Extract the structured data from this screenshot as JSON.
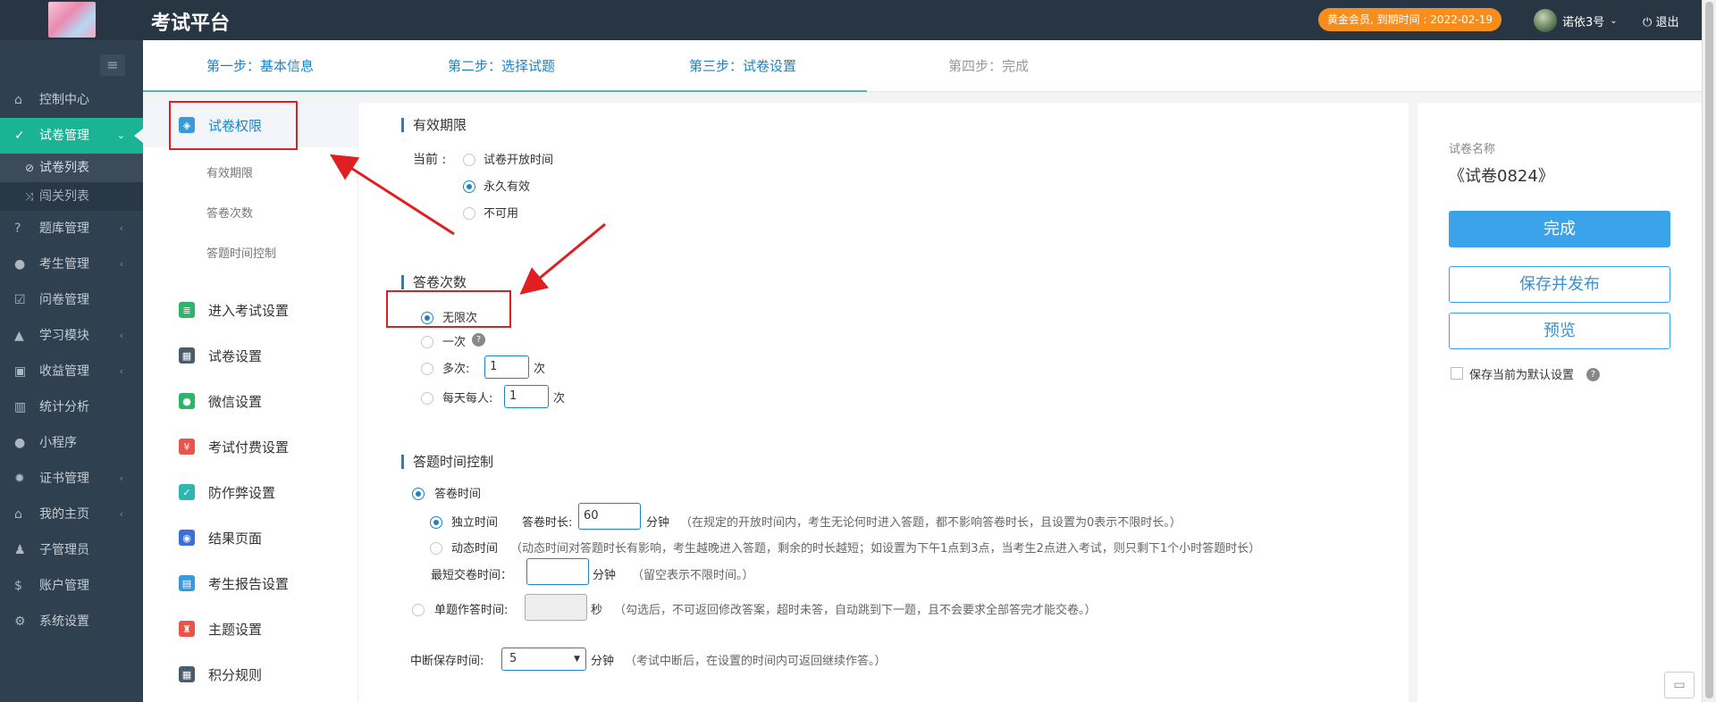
{
  "header": {
    "title": "考试平台",
    "member_badge": "黄金会员, 到期时间 : 2022-02-19",
    "username": "诺依3号",
    "logout": "退出"
  },
  "sidebar": {
    "items": [
      {
        "label": "控制中心",
        "icon": "home-icon"
      },
      {
        "label": "试卷管理",
        "icon": "check-circle-icon",
        "active": true
      },
      {
        "label": "题库管理",
        "icon": "question-circle-icon"
      },
      {
        "label": "考生管理",
        "icon": "user-icon"
      },
      {
        "label": "问卷管理",
        "icon": "check-square-icon"
      },
      {
        "label": "学习模块",
        "icon": "graduation-cap-icon"
      },
      {
        "label": "收益管理",
        "icon": "money-icon"
      },
      {
        "label": "统计分析",
        "icon": "bar-chart-icon"
      },
      {
        "label": "小程序",
        "icon": "wechat-icon"
      },
      {
        "label": "证书管理",
        "icon": "certificate-icon"
      },
      {
        "label": "我的主页",
        "icon": "bank-icon"
      },
      {
        "label": "子管理员",
        "icon": "user-secret-icon"
      },
      {
        "label": "账户管理",
        "icon": "dollar-icon"
      },
      {
        "label": "系统设置",
        "icon": "gear-icon"
      }
    ],
    "subitems": [
      {
        "label": "试卷列表",
        "icon": "check-circle-icon"
      },
      {
        "label": "闯关列表",
        "icon": "random-icon"
      }
    ]
  },
  "steps": [
    "第一步：基本信息",
    "第二步：选择试题",
    "第三步：试卷设置",
    "第四步：完成"
  ],
  "leftmenu": {
    "items": [
      {
        "label": "试卷权限"
      },
      {
        "label": "进入考试设置"
      },
      {
        "label": "试卷设置"
      },
      {
        "label": "微信设置"
      },
      {
        "label": "考试付费设置"
      },
      {
        "label": "防作弊设置"
      },
      {
        "label": "结果页面"
      },
      {
        "label": "考生报告设置"
      },
      {
        "label": "主题设置"
      },
      {
        "label": "积分规则"
      }
    ],
    "subs": [
      "有效期限",
      "答卷次数",
      "答题时间控制"
    ]
  },
  "validity": {
    "title": "有效期限",
    "current_label": "当前 :",
    "options": [
      "试卷开放时间",
      "永久有效",
      "不可用"
    ]
  },
  "attempts": {
    "title": "答卷次数",
    "unlimited": "无限次",
    "once": "一次",
    "multiple": "多次:",
    "multiple_value": "1",
    "daily": "每天每人:",
    "daily_value": "1",
    "unit": "次"
  },
  "timing": {
    "title": "答题时间控制",
    "answer_time": "答卷时间",
    "independent": "独立时间",
    "duration_label": "答卷时长:",
    "duration_value": "60",
    "minute": "分钟",
    "independent_hint": "（在规定的开放时间内，考生无论何时进入答题，都不影响答卷时长，且设置为0表示不限时长。）",
    "dynamic": "动态时间",
    "dynamic_hint": "（动态时间对答题时长有影响，考生越晚进入答题，剩余的时长越短；如设置为下午1点到3点，当考生2点进入考试，则只剩下1个小时答题时长）",
    "min_submit_label": "最短交卷时间：",
    "min_submit_hint": "（留空表示不限时间。）",
    "single_label": "单题作答时间:",
    "second": "秒",
    "single_hint": "（勾选后，不可返回修改答案，超时未答，自动跳到下一题，且不会要求全部答完才能交卷。）",
    "pause_label": "中断保存时间:",
    "pause_value": "5",
    "pause_hint": "（考试中断后，在设置的时间内可返回继续作答。）"
  },
  "right": {
    "name_label": "试卷名称",
    "name": "《试卷0824》",
    "finish": "完成",
    "save_publish": "保存并发布",
    "preview": "预览",
    "save_default": "保存当前为默认设置"
  }
}
